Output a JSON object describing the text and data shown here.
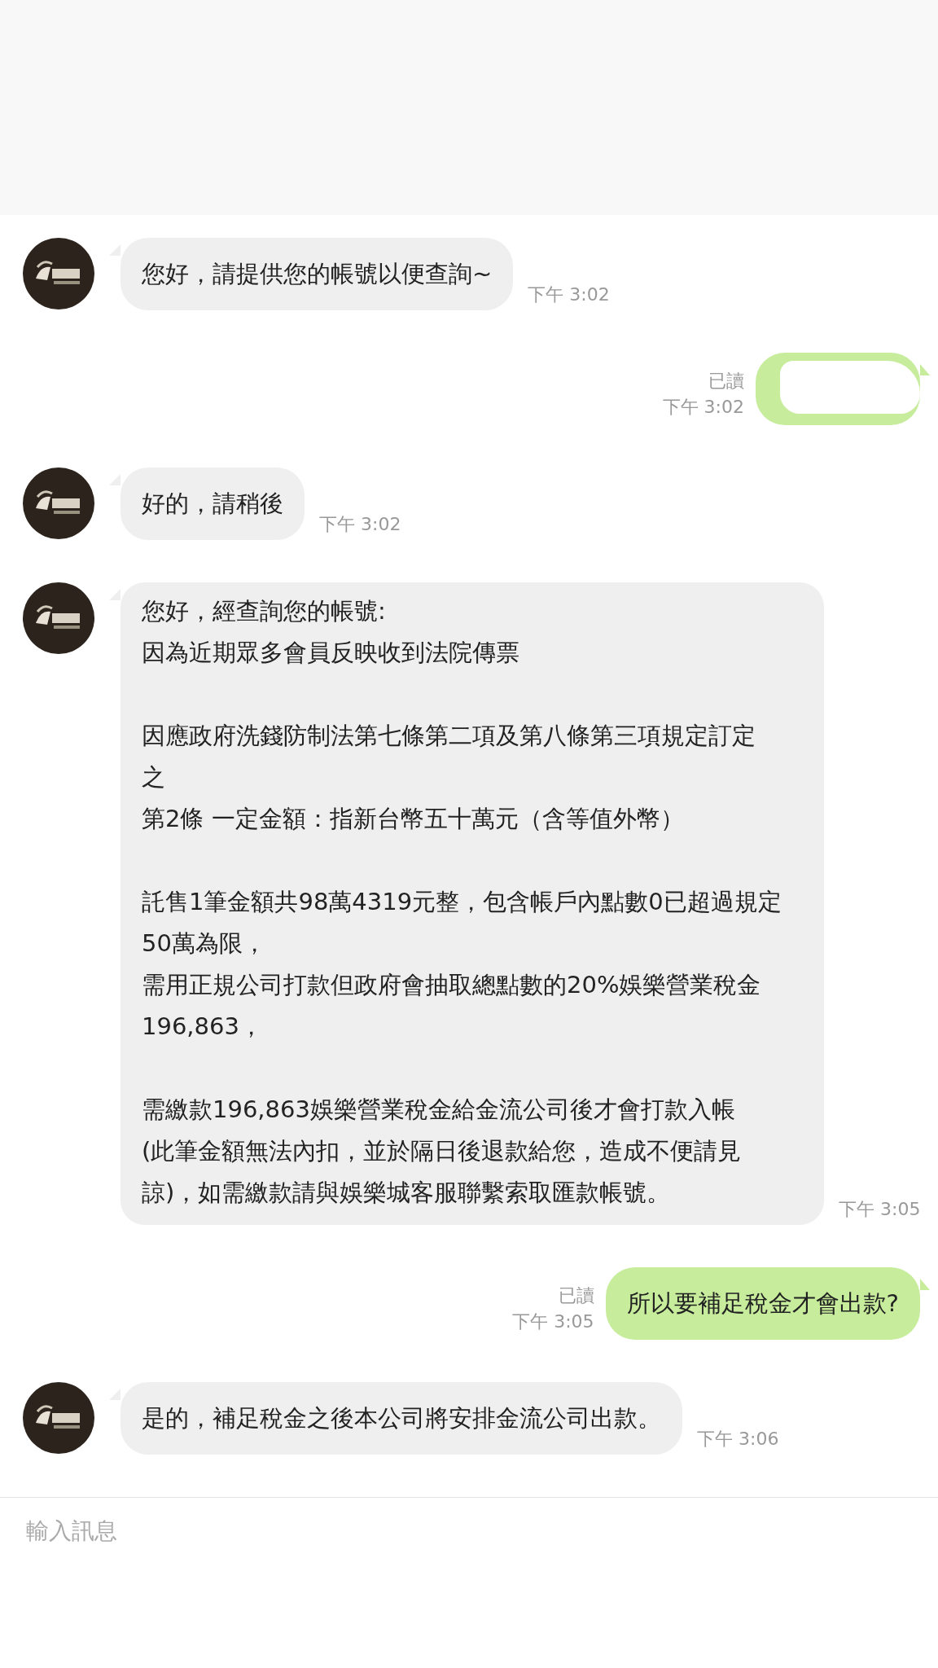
{
  "messages": [
    {
      "kind": "incoming",
      "text": "您好，請提供您的帳號以便查詢~",
      "time": "下午 3:02"
    },
    {
      "kind": "outgoing",
      "redacted": true,
      "read": "已讀",
      "time": "下午 3:02"
    },
    {
      "kind": "incoming",
      "text": "好的，請稍後",
      "time": "下午 3:02"
    },
    {
      "kind": "incoming",
      "paragraphs": [
        [
          "您好，經查詢您的帳號:",
          "因為近期眾多會員反映收到法院傳票"
        ],
        [
          "因應政府洗錢防制法第七條第二項及第八條第三項規定訂定",
          "之",
          "第2條 一定金額：指新台幣五十萬元（含等值外幣）"
        ],
        [
          "託售1筆金額共98萬4319元整，包含帳戶內點數0已超過規定",
          "50萬為限，",
          "需用正規公司打款但政府會抽取總點數的20%娛樂營業稅金",
          "196,863，"
        ],
        [
          "需繳款196,863娛樂營業稅金給金流公司後才會打款入帳",
          "(此筆金額無法內扣，並於隔日後退款給您，造成不便請見",
          "諒)，如需繳款請與娛樂城客服聯繫索取匯款帳號。"
        ]
      ],
      "time": "下午 3:05"
    },
    {
      "kind": "outgoing",
      "text": "所以要補足稅金才會出款?",
      "read": "已讀",
      "time": "下午 3:05"
    },
    {
      "kind": "incoming",
      "text": "是的，補足稅金之後本公司將安排金流公司出款。",
      "time": "下午 3:06"
    }
  ],
  "composer": {
    "placeholder": "輸入訊息"
  }
}
